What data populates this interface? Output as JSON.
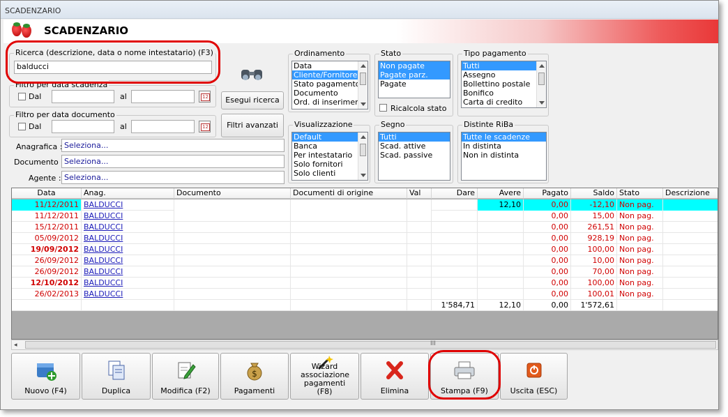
{
  "window": {
    "title": "SCADENZARIO"
  },
  "header": {
    "title": "SCADENZARIO"
  },
  "search": {
    "label": "Ricerca (descrizione, data o nome intestatario) (F3)",
    "value": "balducci",
    "button": "Esegui ricerca",
    "advanced_button": "Filtri avanzati"
  },
  "filter_scadenza": {
    "label": "Filtro per data scadenza",
    "dal": "Dal",
    "al": "al"
  },
  "filter_documento": {
    "label": "Filtro per data documento",
    "dal": "Dal",
    "al": "al"
  },
  "fields": {
    "anagrafica_label": "Anagrafica :",
    "anagrafica_value": "Seleziona...",
    "documento_label": "Documento :",
    "documento_value": "Seleziona...",
    "agente_label": "Agente :",
    "agente_value": "Seleziona..."
  },
  "ordinamento": {
    "label": "Ordinamento",
    "items": [
      "Data",
      "Cliente/Fornitore",
      "Stato pagamento",
      "Documento",
      "Ord. di inserimento"
    ]
  },
  "stato": {
    "label": "Stato",
    "items": [
      "Non pagate",
      "Pagate parz.",
      "Pagate"
    ],
    "ricalcola": "Ricalcola stato"
  },
  "tipo_pagamento": {
    "label": "Tipo pagamento",
    "items": [
      "Tutti",
      "Assegno",
      "Bollettino postale",
      "Bonifico",
      "Carta di credito"
    ]
  },
  "visualizzazione": {
    "label": "Visualizzazione",
    "items": [
      "Default",
      "Banca",
      "Per intestatario",
      "Solo fornitori",
      "Solo clienti"
    ]
  },
  "segno": {
    "label": "Segno",
    "items": [
      "Tutti",
      "Scad. attive",
      "Scad. passive"
    ]
  },
  "distinte": {
    "label": "Distinte RiBa",
    "items": [
      "Tutte le scadenze",
      "In distinta",
      "Non in distinta"
    ]
  },
  "table": {
    "columns": [
      "Data",
      "Anag.",
      "Documento",
      "Documenti di origine",
      "Val",
      "Dare",
      "Avere",
      "Pagato",
      "Saldo",
      "Stato",
      "Descrizione"
    ],
    "rows": [
      {
        "data": "11/12/2011",
        "anag": "BALDUCCI",
        "dare": "",
        "avere": "12,10",
        "pagato": "0,00",
        "saldo": "-12,10",
        "stato": "Non pag.",
        "bold": false,
        "selected": true
      },
      {
        "data": "11/12/2011",
        "anag": "BALDUCCI",
        "dare": "",
        "avere": "",
        "pagato": "0,00",
        "saldo": "15,00",
        "stato": "Non pag.",
        "bold": false,
        "selected": false
      },
      {
        "data": "15/12/2011",
        "anag": "BALDUCCI",
        "dare": "",
        "avere": "",
        "pagato": "0,00",
        "saldo": "261,51",
        "stato": "Non pag.",
        "bold": false,
        "selected": false
      },
      {
        "data": "05/09/2012",
        "anag": "BALDUCCI",
        "dare": "",
        "avere": "",
        "pagato": "0,00",
        "saldo": "928,19",
        "stato": "Non pag.",
        "bold": false,
        "selected": false
      },
      {
        "data": "19/09/2012",
        "anag": "BALDUCCI",
        "dare": "",
        "avere": "",
        "pagato": "0,00",
        "saldo": "100,00",
        "stato": "Non pag.",
        "bold": true,
        "selected": false
      },
      {
        "data": "26/09/2012",
        "anag": "BALDUCCI",
        "dare": "",
        "avere": "",
        "pagato": "0,00",
        "saldo": "10,00",
        "stato": "Non pag.",
        "bold": false,
        "selected": false
      },
      {
        "data": "26/09/2012",
        "anag": "BALDUCCI",
        "dare": "",
        "avere": "",
        "pagato": "0,00",
        "saldo": "70,00",
        "stato": "Non pag.",
        "bold": false,
        "selected": false
      },
      {
        "data": "12/10/2012",
        "anag": "BALDUCCI",
        "dare": "",
        "avere": "",
        "pagato": "0,00",
        "saldo": "100,00",
        "stato": "Non pag.",
        "bold": true,
        "selected": false
      },
      {
        "data": "26/02/2013",
        "anag": "BALDUCCI",
        "dare": "",
        "avere": "",
        "pagato": "0,00",
        "saldo": "100,01",
        "stato": "Non pag.",
        "bold": false,
        "selected": false
      }
    ],
    "totals": {
      "dare": "1'584,71",
      "avere": "12,10",
      "pagato": "0,00",
      "saldo": "1'572,61"
    },
    "scroll_grip": "III"
  },
  "toolbar": {
    "nuovo": "Nuovo (F4)",
    "duplica": "Duplica",
    "modifica": "Modifica (F2)",
    "pagamenti": "Pagamenti",
    "wizard": "Wizard associazione pagamenti (F8)",
    "elimina": "Elimina",
    "stampa": "Stampa (F9)",
    "uscita": "Uscita (ESC)"
  },
  "colors": {
    "selection": "#3399ff",
    "row_highlight": "#00ffff",
    "red_text": "#d00000",
    "callout": "#e00000"
  }
}
